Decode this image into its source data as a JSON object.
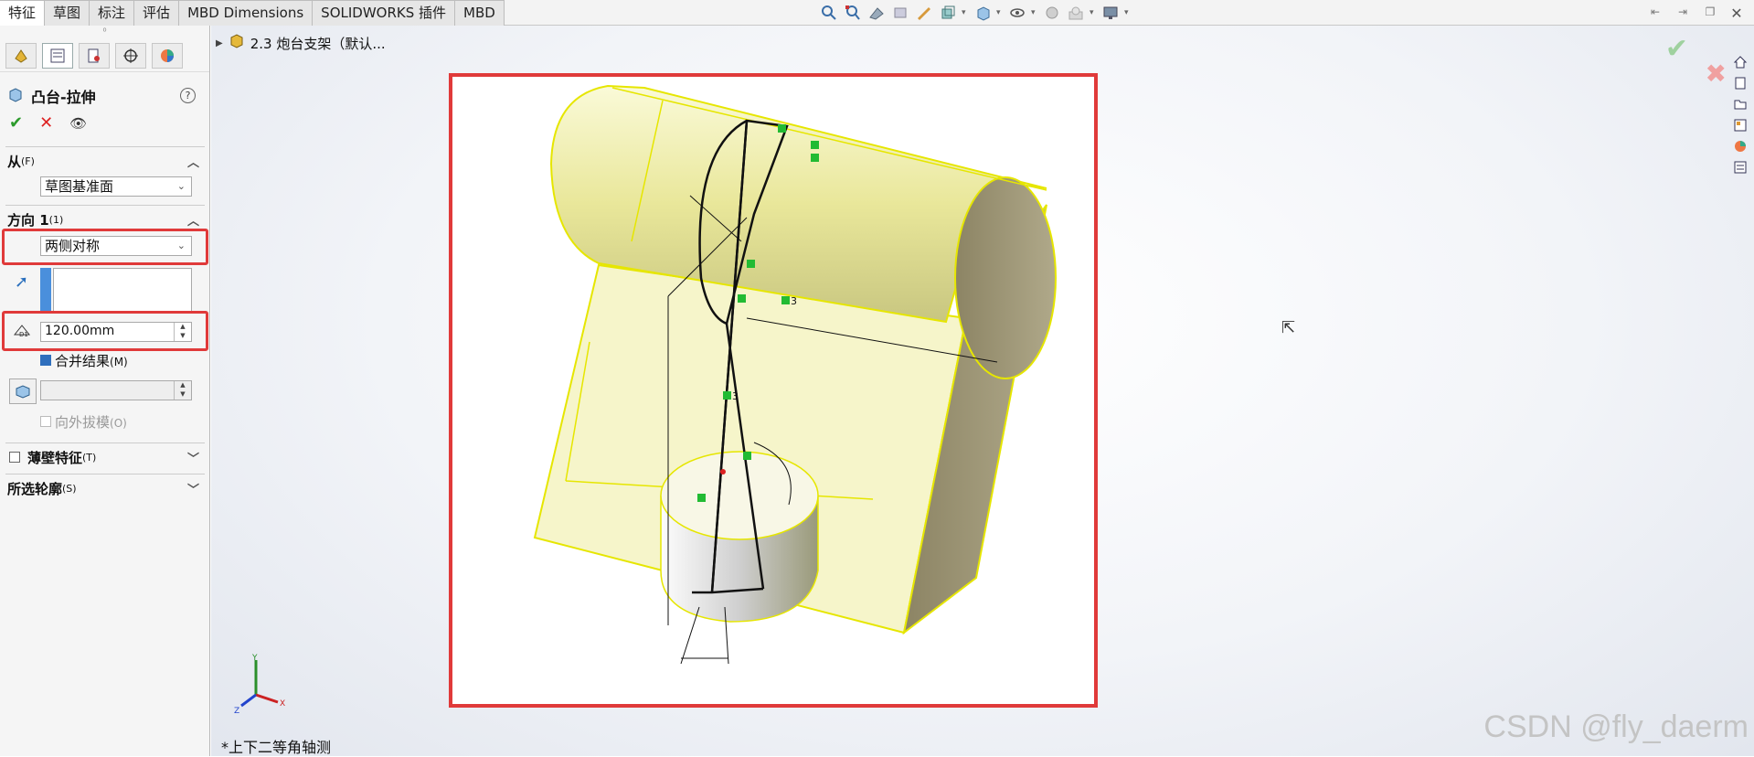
{
  "tabs": [
    "特征",
    "草图",
    "标注",
    "评估",
    "MBD Dimensions",
    "SOLIDWORKS 插件",
    "MBD"
  ],
  "active_tab": 0,
  "hud_icons": [
    "zoom-to-fit-icon",
    "zoom-area-icon",
    "previous-view-icon",
    "section-view-icon",
    "dynamic-annotation-icon",
    "view-orientation-icon",
    "display-style-icon",
    "hide-show-icon",
    "edit-appearance-icon",
    "scene-icon",
    "view-settings-icon"
  ],
  "property_manager": {
    "grip": "⁰",
    "title": "凸台-拉伸",
    "help": "?",
    "ok": "✔",
    "cancel": "✕",
    "preview": "👁",
    "from": {
      "label": "从",
      "hotkey": "(F)",
      "value": "草图基准面"
    },
    "direction1": {
      "label": "方向 1",
      "hotkey": "(1)",
      "end_condition": "两侧对称",
      "depth": "120.00mm"
    },
    "merge_result": {
      "label": "合并结果",
      "hotkey": "(M)",
      "checked": true
    },
    "draft_outward": {
      "label": "向外拔模",
      "hotkey": "(O)"
    },
    "thin_feature": {
      "label": "薄壁特征",
      "hotkey": "(T)"
    },
    "selected_contours": {
      "label": "所选轮廓",
      "hotkey": "(S)"
    }
  },
  "viewport": {
    "tree_node": "2.3 炮台支架（默认...",
    "view_label": "*上下二等角轴测",
    "watermark": "CSDN @fly_daerm",
    "dimension_marks": [
      "3",
      "3"
    ],
    "triad": {
      "x": "X",
      "y": "Y",
      "z": "Z"
    }
  },
  "colors": {
    "highlight": "#e03a3a",
    "body_fill": "#f3f1b3",
    "edge": "#e6e600",
    "relation": "#22bb33"
  }
}
